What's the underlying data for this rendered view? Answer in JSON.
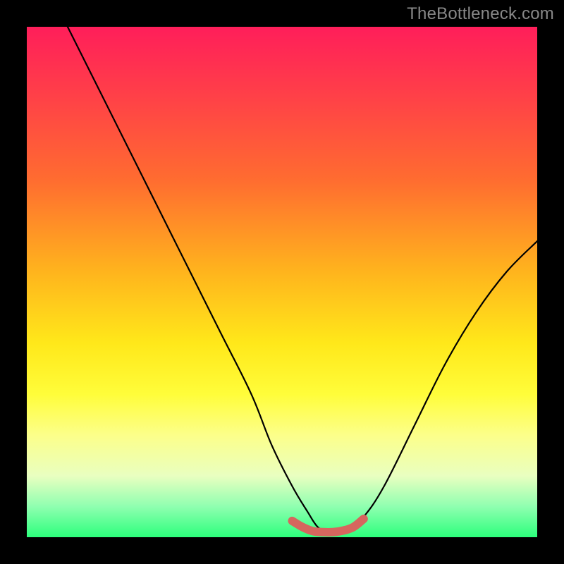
{
  "watermark": "TheBottleneck.com",
  "chart_data": {
    "type": "line",
    "title": "",
    "xlabel": "",
    "ylabel": "",
    "xlim": [
      0,
      100
    ],
    "ylim": [
      0,
      100
    ],
    "series": [
      {
        "name": "curve-main",
        "color": "#000000",
        "x": [
          8,
          14,
          20,
          26,
          32,
          38,
          44,
          48,
          52,
          55,
          57,
          59,
          61,
          63,
          66,
          70,
          76,
          82,
          88,
          94,
          100
        ],
        "y": [
          100,
          88,
          76,
          64,
          52,
          40,
          28,
          18,
          10,
          5,
          2,
          1,
          1,
          1.5,
          4,
          10,
          22,
          34,
          44,
          52,
          58
        ]
      },
      {
        "name": "curve-overlay",
        "color": "#d6665e",
        "x": [
          52,
          54,
          56,
          58,
          60,
          62,
          64,
          66
        ],
        "y": [
          3.2,
          2.0,
          1.2,
          1.0,
          1.0,
          1.3,
          2.0,
          3.6
        ]
      }
    ]
  }
}
